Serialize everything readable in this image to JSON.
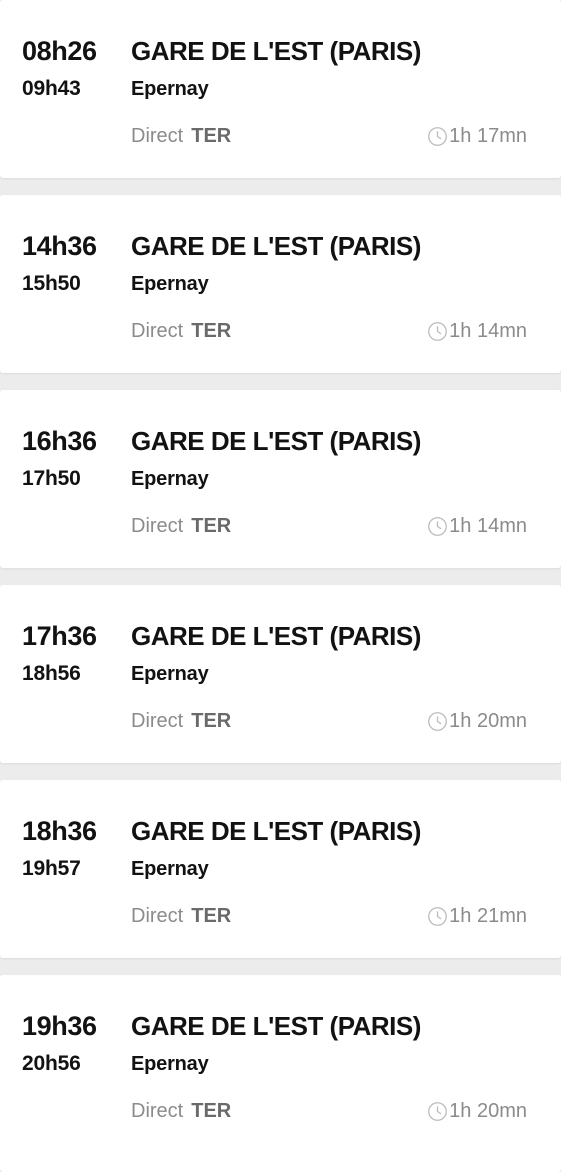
{
  "theme": {
    "page_background": "#ececec",
    "card_background": "#ffffff",
    "primary_text": "#121212",
    "muted_text": "#8b8b8b",
    "train_type_text": "#6a6a6a",
    "icon_stroke": "#b8b8b8"
  },
  "icons": {
    "clock": "clock-icon"
  },
  "results": [
    {
      "departure_time": "08h26",
      "arrival_time": "09h43",
      "origin_station": "GARE DE L'EST (PARIS)",
      "destination_station": "Epernay",
      "connection_label": "Direct",
      "train_type": "TER",
      "duration": "1h 17mn"
    },
    {
      "departure_time": "14h36",
      "arrival_time": "15h50",
      "origin_station": "GARE DE L'EST (PARIS)",
      "destination_station": "Epernay",
      "connection_label": "Direct",
      "train_type": "TER",
      "duration": "1h 14mn"
    },
    {
      "departure_time": "16h36",
      "arrival_time": "17h50",
      "origin_station": "GARE DE L'EST (PARIS)",
      "destination_station": "Epernay",
      "connection_label": "Direct",
      "train_type": "TER",
      "duration": "1h 14mn"
    },
    {
      "departure_time": "17h36",
      "arrival_time": "18h56",
      "origin_station": "GARE DE L'EST (PARIS)",
      "destination_station": "Epernay",
      "connection_label": "Direct",
      "train_type": "TER",
      "duration": "1h 20mn"
    },
    {
      "departure_time": "18h36",
      "arrival_time": "19h57",
      "origin_station": "GARE DE L'EST (PARIS)",
      "destination_station": "Epernay",
      "connection_label": "Direct",
      "train_type": "TER",
      "duration": "1h 21mn"
    },
    {
      "departure_time": "19h36",
      "arrival_time": "20h56",
      "origin_station": "GARE DE L'EST (PARIS)",
      "destination_station": "Epernay",
      "connection_label": "Direct",
      "train_type": "TER",
      "duration": "1h 20mn"
    }
  ]
}
